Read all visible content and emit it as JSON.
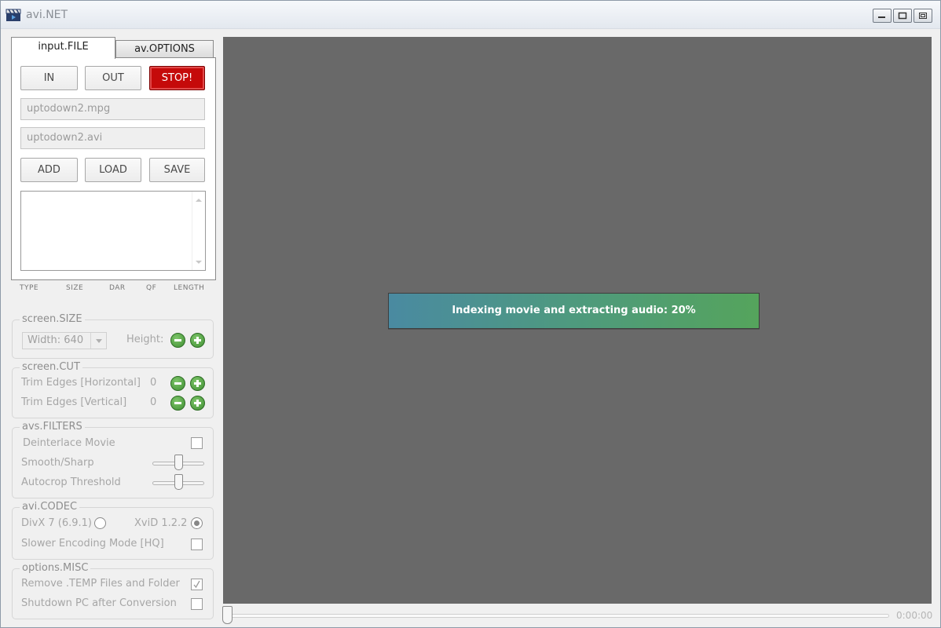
{
  "window": {
    "title": "avi.NET"
  },
  "tabs": [
    {
      "label": "input.FILE",
      "active": true
    },
    {
      "label": "av.OPTIONS",
      "active": false
    }
  ],
  "input": {
    "in_label": "IN",
    "out_label": "OUT",
    "stop_label": "STOP!",
    "input_file": "uptodown2.mpg",
    "output_file": "uptodown2.avi",
    "add_label": "ADD",
    "load_label": "LOAD",
    "save_label": "SAVE",
    "columns": [
      "TYPE",
      "SIZE",
      "DAR",
      "QF",
      "LENGTH"
    ]
  },
  "screen_size": {
    "legend": "screen.SIZE",
    "width_value": "Width: 640",
    "height_label": "Height:"
  },
  "screen_cut": {
    "legend": "screen.CUT",
    "horizontal_label": "Trim Edges [Horizontal]",
    "horizontal_value": "0",
    "vertical_label": "Trim Edges [Vertical]",
    "vertical_value": "0"
  },
  "filters": {
    "legend": "avs.FILTERS",
    "deinterlace_label": "Deinterlace Movie",
    "smooth_label": "Smooth/Sharp",
    "autocrop_label": "Autocrop Threshold"
  },
  "codec": {
    "legend": "avi.CODEC",
    "divx_label": "DivX 7 (6.9.1)",
    "xvid_label": "XviD 1.2.2",
    "hq_label": "Slower Encoding Mode [HQ]"
  },
  "misc": {
    "legend": "options.MISC",
    "remove_temp_label": "Remove .TEMP Files and Folder",
    "shutdown_label": "Shutdown PC after Conversion"
  },
  "status": {
    "progress_text": "Indexing movie and extracting audio: 20%",
    "time": "0:00:00"
  },
  "colors": {
    "stop_button": "#c50a0a",
    "video_background": "#696969",
    "progress_start": "#4a8aa1",
    "progress_end": "#55a45c",
    "circle_button": "#4e9e3e"
  }
}
